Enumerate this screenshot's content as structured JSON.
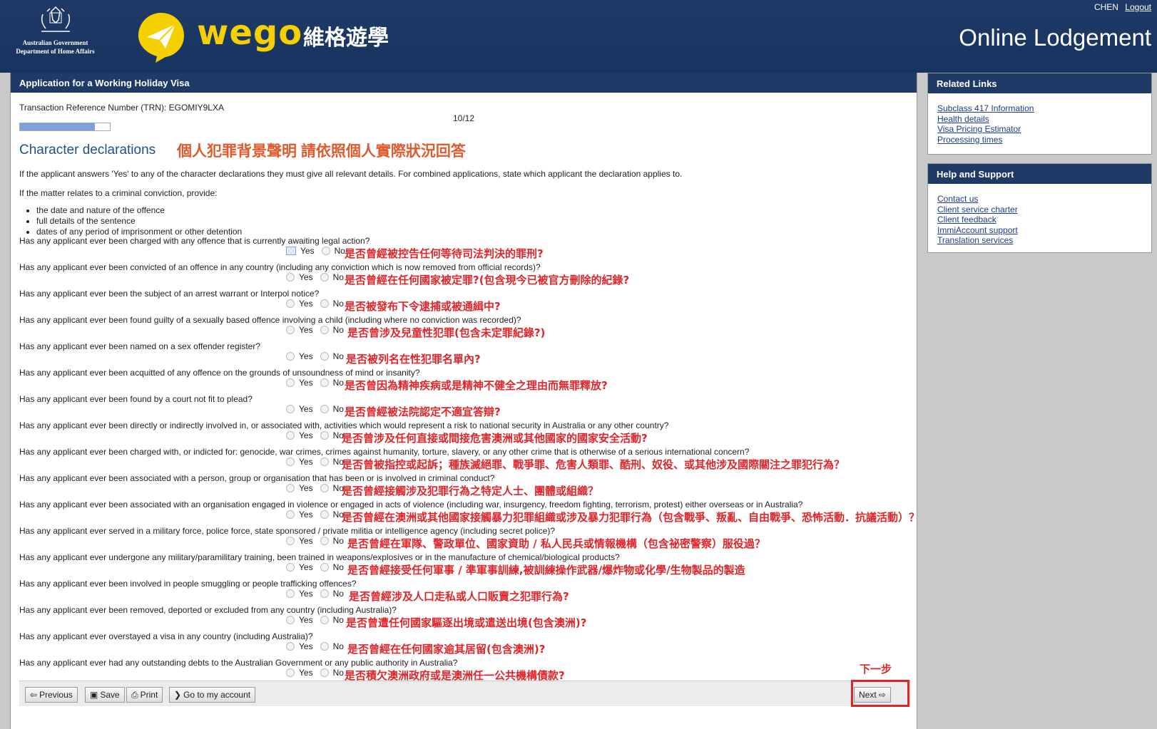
{
  "header": {
    "user": "CHEN",
    "logout": "Logout",
    "gov_line1": "Australian Government",
    "gov_line2": "Department of Home Affairs",
    "wego_word": "wego",
    "wego_cn": "維格遊學",
    "title": "Online Lodgement",
    "colors": {
      "banner": "#1f3a66",
      "wego_yellow": "#f5d000"
    }
  },
  "main": {
    "panel_title": "Application for a Working Holiday Visa",
    "trn": "Transaction Reference Number (TRN): EGOMIY9LXA",
    "page_count": "10/12",
    "progress": 0.83,
    "section_title": "Character declarations",
    "section_cn": "個人犯罪背景聲明 請依照個人實際狀況回答",
    "intro1": "If the applicant answers 'Yes' to any of the character declarations they must give all relevant details. For combined applications, state which applicant the declaration applies to.",
    "intro2": "If the matter relates to a criminal conviction, provide:",
    "bullets": [
      "the date and nature of the offence",
      "full details of the sentence",
      "dates of any period of imprisonment or other detention"
    ],
    "yes_label": "Yes",
    "no_label": "No",
    "questions": [
      {
        "text": "Has any applicant ever been charged with any offence that is currently awaiting legal action?",
        "cn": "是否曾經被控告任何等待司法判決的罪刑?"
      },
      {
        "text": "Has any applicant ever been convicted of an offence in any country (including any conviction which is now removed from official records)?",
        "cn": "是否曾經在任何國家被定罪?(包含現今已被官方刪除的紀錄?"
      },
      {
        "text": "Has any applicant ever been the subject of an arrest warrant or Interpol notice?",
        "cn": "是否被發布下令逮捕或被通緝中?"
      },
      {
        "text": "Has any applicant ever been found guilty of a sexually based offence involving a child (including where no conviction was recorded)?",
        "cn": "是否曾涉及兒童性犯罪(包含未定罪紀錄?)"
      },
      {
        "text": "Has any applicant ever been named on a sex offender register?",
        "cn": "是否被列名在性犯罪名單內?"
      },
      {
        "text": "Has any applicant ever been acquitted of any offence on the grounds of unsoundness of mind or insanity?",
        "cn": "是否曾因為精神疾病或是精神不健全之理由而無罪釋放?"
      },
      {
        "text": "Has any applicant ever been found by a court not fit to plead?",
        "cn": "是否曾經被法院認定不適宜答辯?"
      },
      {
        "text": "Has any applicant ever been directly or indirectly involved in, or associated with, activities which would represent a risk to national security in Australia or any other country?",
        "cn": "是否曾涉及任何直接或間接危害澳洲或其他國家的國家安全活動?"
      },
      {
        "text": "Has any applicant ever been charged with, or indicted for: genocide, war crimes, crimes against humanity, torture, slavery, or any other crime that is otherwise of a serious international concern?",
        "cn": "是否曾被指控或起訴；種族滅絕罪、戰爭罪、危害人類罪、酷刑、奴役、或其他涉及國際關注之罪犯行為？"
      },
      {
        "text": "Has any applicant ever been associated with a person, group or organisation that has been or is involved in criminal conduct?",
        "cn": "是否曾經接觸涉及犯罪行為之特定人士、團體或組織？"
      },
      {
        "text": "Has any applicant ever been associated with an organisation engaged in violence or engaged in acts of violence (including war, insurgency, freedom fighting, terrorism, protest) either overseas or in Australia?",
        "cn": "是否曾經在澳洲或其他國家接觸暴力犯罪組織或涉及暴力犯罪行為（包含戰爭、叛亂、自由戰爭、恐怖活動．抗議活動）？"
      },
      {
        "text": "Has any applicant ever served in a military force, police force, state sponsored / private militia or intelligence agency (including secret police)?",
        "cn": "是否曾經在軍隊、警政單位、國家資助 / 私人民兵或情報機構（包含祕密警察）服役過？"
      },
      {
        "text": "Has any applicant ever undergone any military/paramilitary training, been trained in weapons/explosives or in the manufacture of chemical/biological products?",
        "cn": "是否曾經接受任何軍事 / 準軍事訓練,被訓練操作武器/爆炸物或化學/生物製品的製造"
      },
      {
        "text": "Has any applicant ever been involved in people smuggling or people trafficking offences?",
        "cn": "是否曾經涉及人口走私或人口販賣之犯罪行為?"
      },
      {
        "text": "Has any applicant ever been removed, deported or excluded from any country (including Australia)?",
        "cn": "是否曾遭任何國家驅逐出境或遣送出境(包含澳洲)?"
      },
      {
        "text": "Has any applicant ever overstayed a visa in any country (including Australia)?",
        "cn": "是否曾經在任何國家逾其居留(包含澳洲)?"
      },
      {
        "text": "Has any applicant ever had any outstanding debts to the Australian Government or any public authority in Australia?",
        "cn": "是否積欠澳洲政府或是澳洲任一公共機構債款?"
      }
    ],
    "next_cn": "下一步",
    "buttons": {
      "previous": "Previous",
      "save": "Save",
      "print": "Print",
      "go_to_account": "Go to my account",
      "next": "Next"
    }
  },
  "sidebar": {
    "related_title": "Related Links",
    "related_links": [
      "Subclass 417 Information",
      "Health details",
      "Visa Pricing Estimator",
      "Processing times"
    ],
    "help_title": "Help and Support",
    "help_links": [
      "Contact us",
      "Client service charter",
      "Client feedback",
      "ImmiAccount support",
      "Translation services"
    ]
  }
}
